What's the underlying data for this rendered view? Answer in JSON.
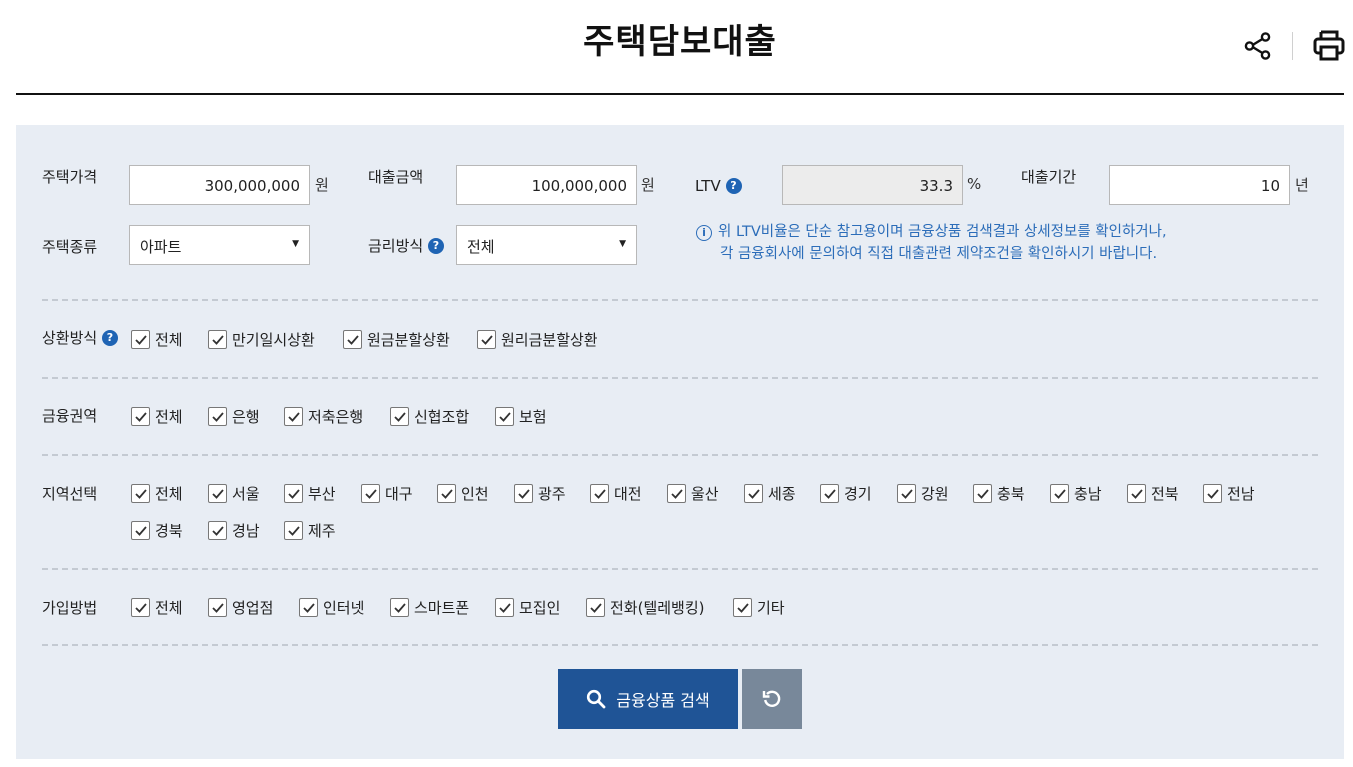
{
  "page": {
    "title": "주택담보대출",
    "share_icon": "share-icon",
    "print_icon": "print-icon"
  },
  "form": {
    "house_price": {
      "label": "주택가격",
      "value": "300,000,000",
      "unit": "원"
    },
    "loan_amount": {
      "label": "대출금액",
      "value": "100,000,000",
      "unit": "원"
    },
    "ltv": {
      "label": "LTV",
      "value": "33.3",
      "unit": "%",
      "help_icon": "question-icon"
    },
    "loan_period": {
      "label": "대출기간",
      "value": "10",
      "unit": "년"
    },
    "house_type": {
      "label": "주택종류",
      "selected": "아파트"
    },
    "rate_type": {
      "label": "금리방식",
      "selected": "전체",
      "help_icon": "question-icon"
    },
    "notice": {
      "icon": "info-icon",
      "line1": "위 LTV비율은 단순 참고용이며 금융상품 검색결과 상세정보를 확인하거나,",
      "line2": "각 금융회사에 문의하여 직접 대출관련 제약조건을 확인하시기 바랍니다."
    }
  },
  "filters": {
    "repayment": {
      "label": "상환방식",
      "options": [
        {
          "label": "전체",
          "checked": true
        },
        {
          "label": "만기일시상환",
          "checked": true
        },
        {
          "label": "원금분할상환",
          "checked": true
        },
        {
          "label": "원리금분할상환",
          "checked": true
        }
      ]
    },
    "sector": {
      "label": "금융권역",
      "options": [
        {
          "label": "전체",
          "checked": true
        },
        {
          "label": "은행",
          "checked": true
        },
        {
          "label": "저축은행",
          "checked": true
        },
        {
          "label": "신협조합",
          "checked": true
        },
        {
          "label": "보험",
          "checked": true
        }
      ]
    },
    "region": {
      "label": "지역선택",
      "options": [
        {
          "label": "전체",
          "checked": true
        },
        {
          "label": "서울",
          "checked": true
        },
        {
          "label": "부산",
          "checked": true
        },
        {
          "label": "대구",
          "checked": true
        },
        {
          "label": "인천",
          "checked": true
        },
        {
          "label": "광주",
          "checked": true
        },
        {
          "label": "대전",
          "checked": true
        },
        {
          "label": "울산",
          "checked": true
        },
        {
          "label": "세종",
          "checked": true
        },
        {
          "label": "경기",
          "checked": true
        },
        {
          "label": "강원",
          "checked": true
        },
        {
          "label": "충북",
          "checked": true
        },
        {
          "label": "충남",
          "checked": true
        },
        {
          "label": "전북",
          "checked": true
        },
        {
          "label": "전남",
          "checked": true
        },
        {
          "label": "경북",
          "checked": true
        },
        {
          "label": "경남",
          "checked": true
        },
        {
          "label": "제주",
          "checked": true
        }
      ]
    },
    "channel": {
      "label": "가입방법",
      "options": [
        {
          "label": "전체",
          "checked": true
        },
        {
          "label": "영업점",
          "checked": true
        },
        {
          "label": "인터넷",
          "checked": true
        },
        {
          "label": "스마트폰",
          "checked": true
        },
        {
          "label": "모집인",
          "checked": true
        },
        {
          "label": "전화(텔레뱅킹)",
          "checked": true
        },
        {
          "label": "기타",
          "checked": true
        }
      ]
    }
  },
  "actions": {
    "search_label": "금융상품 검색",
    "search_icon": "search-icon",
    "reset_icon": "reset-icon"
  },
  "colors": {
    "primary": "#1f5496",
    "panel_bg": "#e8edf4",
    "reset_bg": "#78889a",
    "notice_text": "#2c6db9",
    "help_icon": "#1f64b4"
  }
}
